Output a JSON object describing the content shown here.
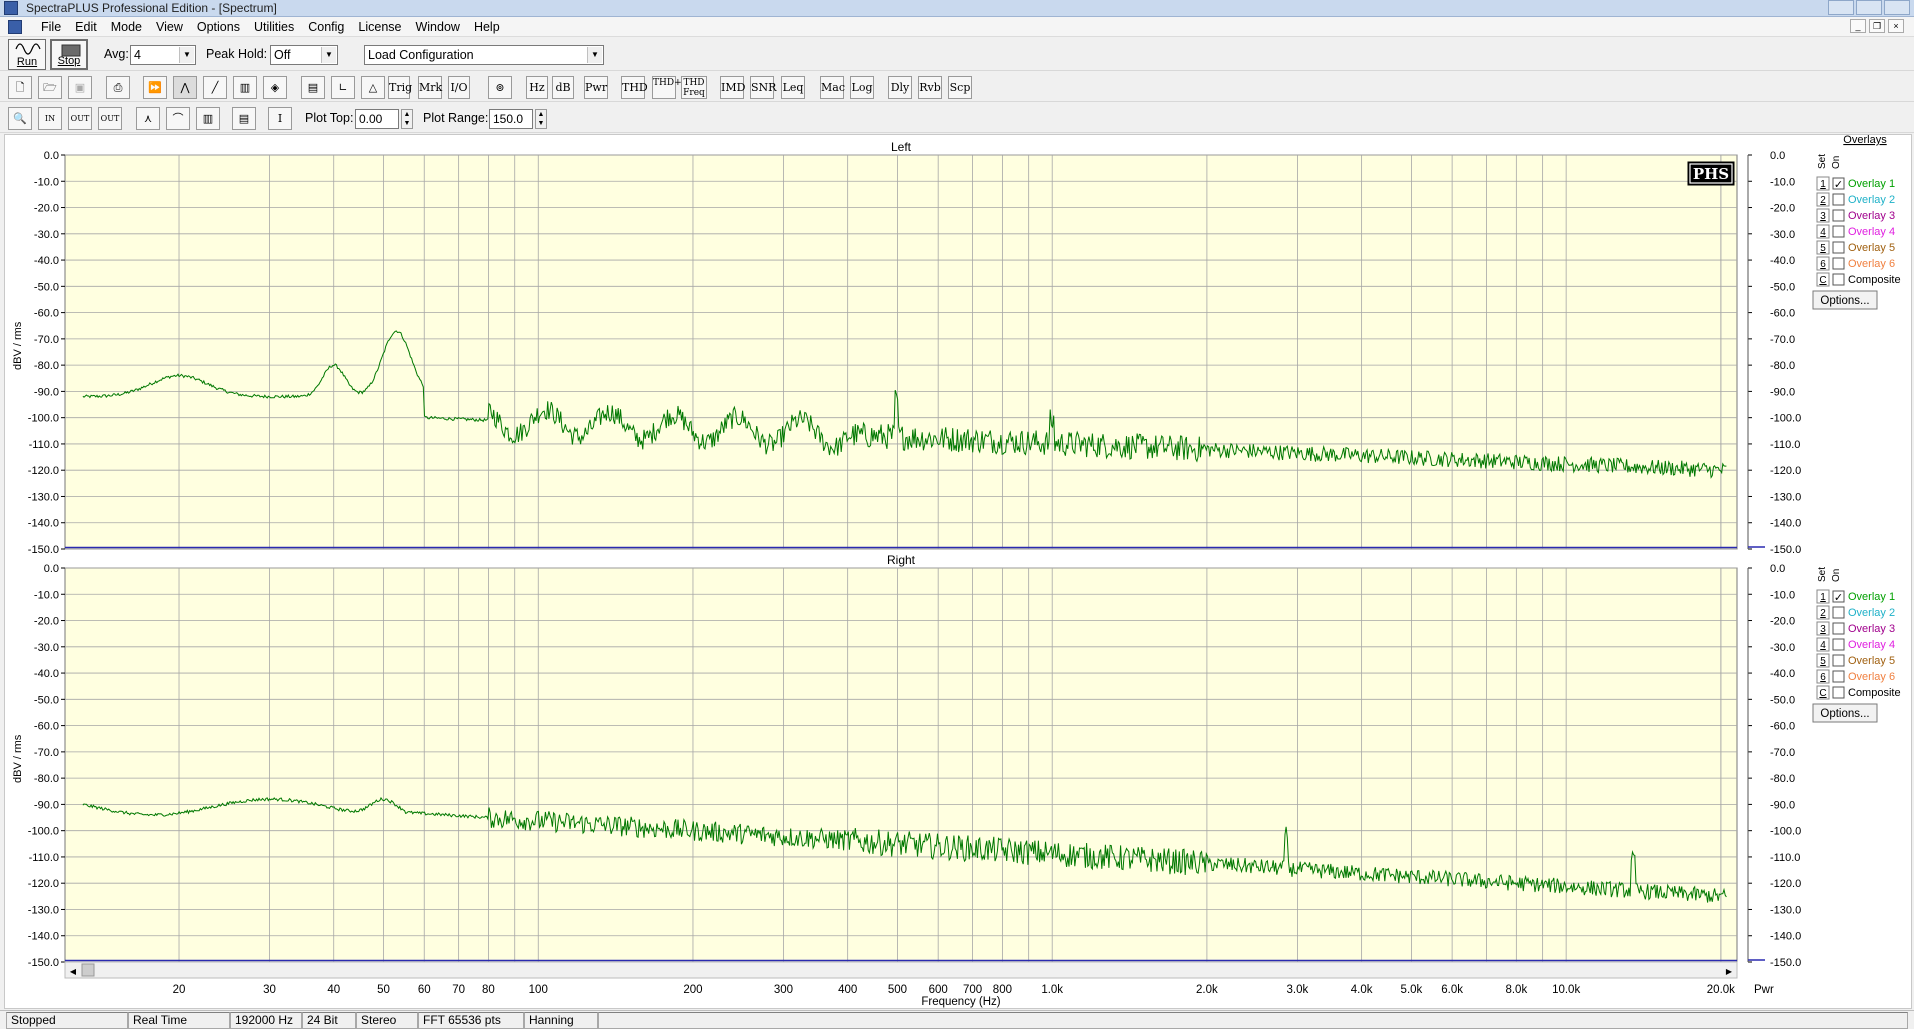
{
  "window": {
    "title": "SpectraPLUS Professional Edition - [Spectrum]"
  },
  "menu": [
    "File",
    "Edit",
    "Mode",
    "View",
    "Options",
    "Utilities",
    "Config",
    "License",
    "Window",
    "Help"
  ],
  "toolbar": {
    "run_label": "Run",
    "stop_label": "Stop",
    "avg_label": "Avg:",
    "avg_value": "4",
    "peak_hold_label": "Peak Hold:",
    "peak_hold_value": "Off",
    "config_value": "Load Configuration",
    "text_buttons": [
      "Trig",
      "Mrk",
      "I/O",
      "Hz",
      "dB",
      "Pwr",
      "THD",
      "THD+N",
      "THD Freq",
      "IMD",
      "SNR",
      "Leq",
      "Mac",
      "Log",
      "Dly",
      "Rvb",
      "Scp"
    ],
    "plot_top_label": "Plot Top:",
    "plot_top_value": "0.00",
    "plot_range_label": "Plot Range:",
    "plot_range_value": "150.0"
  },
  "plots": {
    "left_title": "Left",
    "right_title": "Right",
    "y_axis_title": "dBV / rms",
    "y_ticks": [
      "0.0",
      "-10.0",
      "-20.0",
      "-30.0",
      "-40.0",
      "-50.0",
      "-60.0",
      "-70.0",
      "-80.0",
      "-90.0",
      "-100.0",
      "-110.0",
      "-120.0",
      "-130.0",
      "-140.0",
      "-150.0"
    ],
    "x_ticks": [
      "20",
      "30",
      "40",
      "50",
      "60",
      "70",
      "80",
      "100",
      "200",
      "300",
      "400",
      "500",
      "600",
      "700",
      "800",
      "1.0k",
      "2.0k",
      "3.0k",
      "4.0k",
      "5.0k",
      "6.0k",
      "8.0k",
      "10.0k",
      "20.0k"
    ],
    "x_axis_title": "Frequency (Hz)",
    "pwr_label": "Pwr",
    "logo_text": "PHS",
    "trace_color": "#007800",
    "plot_bg": "#ffffe0"
  },
  "overlays": {
    "header": "Overlays",
    "set_label": "Set",
    "on_label": "On",
    "items": [
      {
        "num": "1",
        "label": "Overlay 1",
        "checked": true,
        "color": "#00a000"
      },
      {
        "num": "2",
        "label": "Overlay 2",
        "checked": false,
        "color": "#1fb1c8"
      },
      {
        "num": "3",
        "label": "Overlay 3",
        "checked": false,
        "color": "#a0008c"
      },
      {
        "num": "4",
        "label": "Overlay 4",
        "checked": false,
        "color": "#e020e0"
      },
      {
        "num": "5",
        "label": "Overlay 5",
        "checked": false,
        "color": "#a06010"
      },
      {
        "num": "6",
        "label": "Overlay 6",
        "checked": false,
        "color": "#f08040"
      },
      {
        "num": "C",
        "label": "Composite",
        "checked": false,
        "color": "#000000"
      }
    ],
    "options_label": "Options..."
  },
  "status": {
    "state": "Stopped",
    "mode": "Real Time",
    "rate": "192000 Hz",
    "bits": "24 Bit",
    "channels": "Stereo",
    "fft": "FFT 65536 pts",
    "window": "Hanning"
  }
}
